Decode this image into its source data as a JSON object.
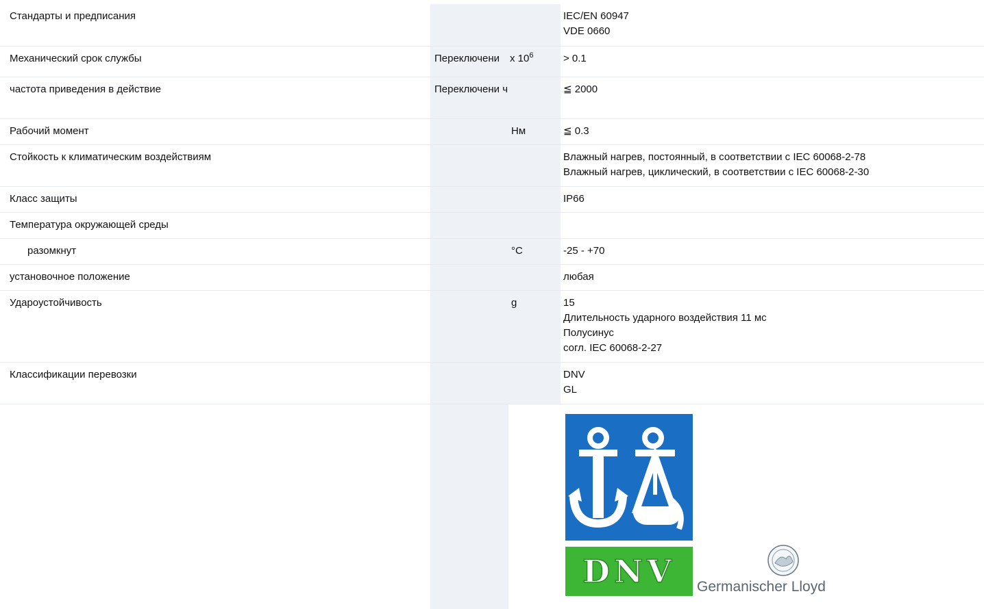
{
  "section_heading_fragment": "",
  "rows": [
    {
      "label": "Стандарты и предписания",
      "unit1": "",
      "unit2": "",
      "values": [
        "IEC/EN 60947",
        "VDE 0660"
      ]
    },
    {
      "label": "Механический срок службы",
      "unit1": "Переключени",
      "unit2_base": "x 10",
      "unit2_sup": "6",
      "values": [
        "> 0.1"
      ]
    },
    {
      "label": "частота приведения в действие",
      "unit1": "Переключени ч",
      "unit2": "",
      "values": [
        "≦ 2000"
      ]
    },
    {
      "label": "Рабочий момент",
      "unit1": "",
      "unit2": "Нм",
      "values": [
        "≦ 0.3"
      ]
    },
    {
      "label": "Стойкость к климатическим воздействиям",
      "unit1": "",
      "unit2": "",
      "values": [
        "Влажный нагрев, постоянный, в соответствии с IEC 60068-2-78",
        "Влажный нагрев, циклический, в соответствии с IEC 60068-2-30"
      ]
    },
    {
      "label": "Класс защиты",
      "unit1": "",
      "unit2": "",
      "values": [
        "IP66"
      ]
    },
    {
      "label": "Температура окружающей среды",
      "unit1": "",
      "unit2": "",
      "values": []
    },
    {
      "label": "разомкнут",
      "unit1": "",
      "unit2": "°C",
      "values": [
        "-25 - +70"
      ]
    },
    {
      "label": "установочное положение",
      "unit1": "",
      "unit2": "",
      "values": [
        "любая"
      ]
    },
    {
      "label": "Удароустойчивость",
      "unit1": "",
      "unit2": "g",
      "values": [
        "15",
        "Длительность ударного воздействия 11 мс",
        "Полусинус",
        "согл. IEC 60068-2-27"
      ]
    },
    {
      "label": "Классификации перевозки",
      "unit1": "",
      "unit2": "",
      "values": [
        "DNV",
        "GL"
      ]
    }
  ],
  "logos": {
    "dnv_text": "DNV",
    "gl_text": "Germanischer Lloyd",
    "colors": {
      "dnv_blue": "#1a6fc4",
      "dnv_green": "#3db535",
      "gl_grey": "#6b7b8a"
    }
  },
  "colors": {
    "unit_column_bg": "#eef1f5",
    "row_border": "#e6e9ee",
    "heading_blue": "#1a78c2"
  }
}
